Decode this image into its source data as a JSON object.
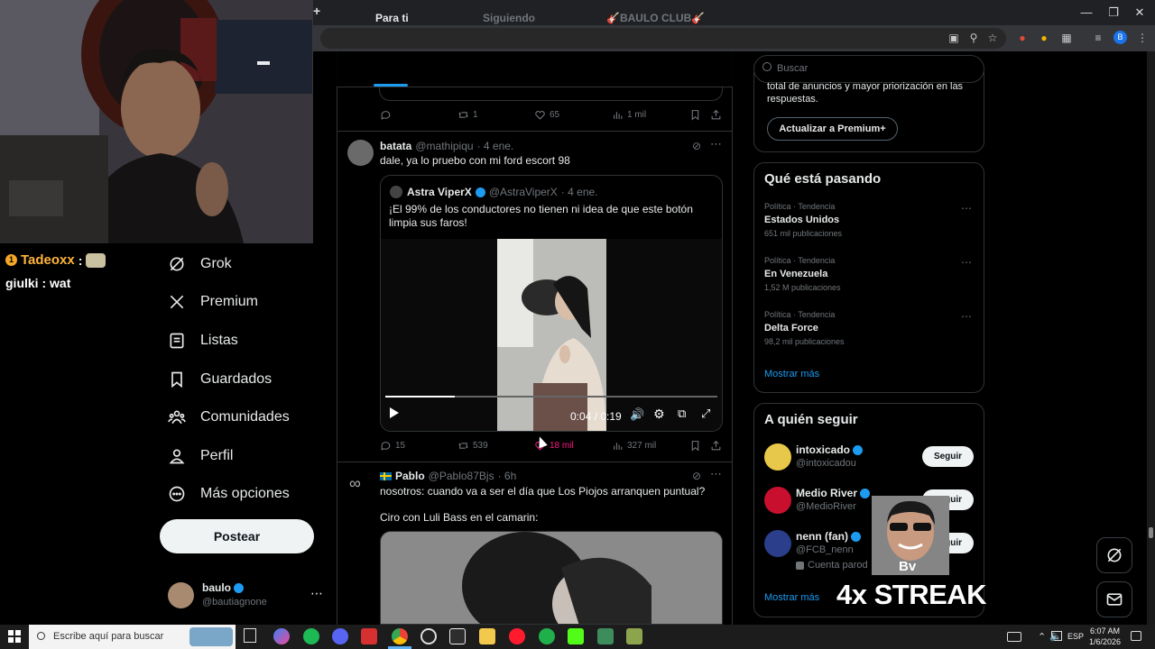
{
  "browser": {
    "new_tab": "+"
  },
  "cam": {
    "overlay_label": "Bv",
    "streak_label": "4x STREAK"
  },
  "chat": [
    {
      "user": "Tadeoxx",
      "sep": " :",
      "message": ""
    },
    {
      "user": "giulki",
      "sep": " :",
      "message": " wat"
    }
  ],
  "nav": {
    "items": [
      {
        "label": "Grok",
        "icon": "grok-icon"
      },
      {
        "label": "Premium",
        "icon": "x-logo-icon"
      },
      {
        "label": "Listas",
        "icon": "list-icon"
      },
      {
        "label": "Guardados",
        "icon": "bookmark-icon"
      },
      {
        "label": "Comunidades",
        "icon": "communities-icon"
      },
      {
        "label": "Perfil",
        "icon": "person-icon"
      },
      {
        "label": "Más opciones",
        "icon": "more-circle-icon"
      }
    ],
    "post_button": "Postear",
    "account_name": "baulo",
    "account_handle": "@bautiagnone"
  },
  "feed": {
    "tabs": [
      "Para ti",
      "Siguiendo",
      "🎸BAULO CLUB🎸"
    ],
    "prev_post_actions": {
      "replies": "",
      "reposts": "1",
      "likes": "65",
      "views": "1 mil"
    },
    "post1": {
      "name": "batata",
      "handle": "@mathipiqu",
      "time": "· 4 ene.",
      "text": "dale, ya lo pruebo con mi ford escort 98",
      "quote": {
        "name": "Astra ViperX",
        "handle": "@AstraViperX",
        "time": "· 4 ene.",
        "text": "¡El 99% de los conductores no tienen ni idea de que este botón limpia sus faros!",
        "video_time": "0:04 / 0:19",
        "progress": 0.21
      },
      "actions": {
        "replies": "15",
        "reposts": "539",
        "likes": "18 mil",
        "views": "327 mil"
      }
    },
    "post2": {
      "name": "Pablo",
      "handle": "@Pablo87Bjs",
      "time": "· 6h",
      "text1": "nosotros: cuando va a ser el día que Los Piojos arranquen puntual?",
      "text2": "Ciro con Luli Bass en el camarin:"
    }
  },
  "sidebar": {
    "search_placeholder": "Buscar",
    "premium_text1": "total de anuncios y mayor priorización en las",
    "premium_text2": "respuestas.",
    "premium_button": "Actualizar a Premium+",
    "trends_title": "Qué está pasando",
    "trends": [
      {
        "category": "Política · Tendencia",
        "name": "Estados Unidos",
        "count": "651 mil publicaciones"
      },
      {
        "category": "Política · Tendencia",
        "name": "En Venezuela",
        "count": "1,52 M publicaciones"
      },
      {
        "category": "Política · Tendencia",
        "name": "Delta Force",
        "count": "98,2 mil publicaciones"
      }
    ],
    "show_more": "Mostrar más",
    "follow_title": "A quién seguir",
    "follow": [
      {
        "name": "intoxicado",
        "handle": "@intoxicadou",
        "button": "Seguir"
      },
      {
        "name": "Medio River",
        "handle": "@MedioRiver",
        "button": "Seguir"
      },
      {
        "name": "nenn (fan)",
        "handle": "@FCB_nenn",
        "button": "Seguir",
        "note": "Cuenta parod"
      }
    ],
    "follow_more": "Mostrar más"
  },
  "taskbar": {
    "search_placeholder": "Escribe aquí para buscar",
    "lang": "ESP",
    "time": "6:07 AM",
    "date": "1/6/2026"
  },
  "colors": {
    "accent": "#1d9bf0",
    "like_active": "#f91880"
  }
}
